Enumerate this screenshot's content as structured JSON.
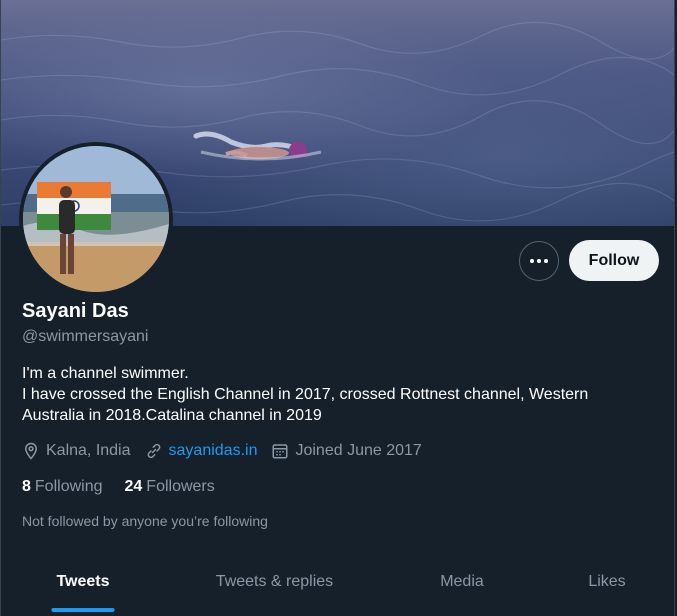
{
  "profile": {
    "name": "Sayani Das",
    "handle": "@swimmersayani",
    "bio_lines": [
      "I'm a channel swimmer.",
      "I have crossed the English Channel in 2017, crossed Rottnest channel, Western",
      "Australia in 2018.Catalina channel in 2019"
    ],
    "location": "Kalna, India",
    "website": "sayanidas.in",
    "joined": "Joined June 2017",
    "following_count": "8",
    "following_label": "Following",
    "followers_count": "24",
    "followers_label": "Followers",
    "not_followed": "Not followed by anyone you’re following"
  },
  "actions": {
    "follow_label": "Follow"
  },
  "tabs": [
    {
      "label": "Tweets",
      "active": true
    },
    {
      "label": "Tweets & replies",
      "active": false
    },
    {
      "label": "Media",
      "active": false
    },
    {
      "label": "Likes",
      "active": false
    }
  ],
  "colors": {
    "background": "#15202b",
    "accent": "#1d9bf0",
    "secondary_text": "#8b98a5",
    "follow_button_bg": "#eff3f4"
  },
  "icons": [
    "more-icon",
    "location-icon",
    "link-icon",
    "calendar-icon"
  ]
}
